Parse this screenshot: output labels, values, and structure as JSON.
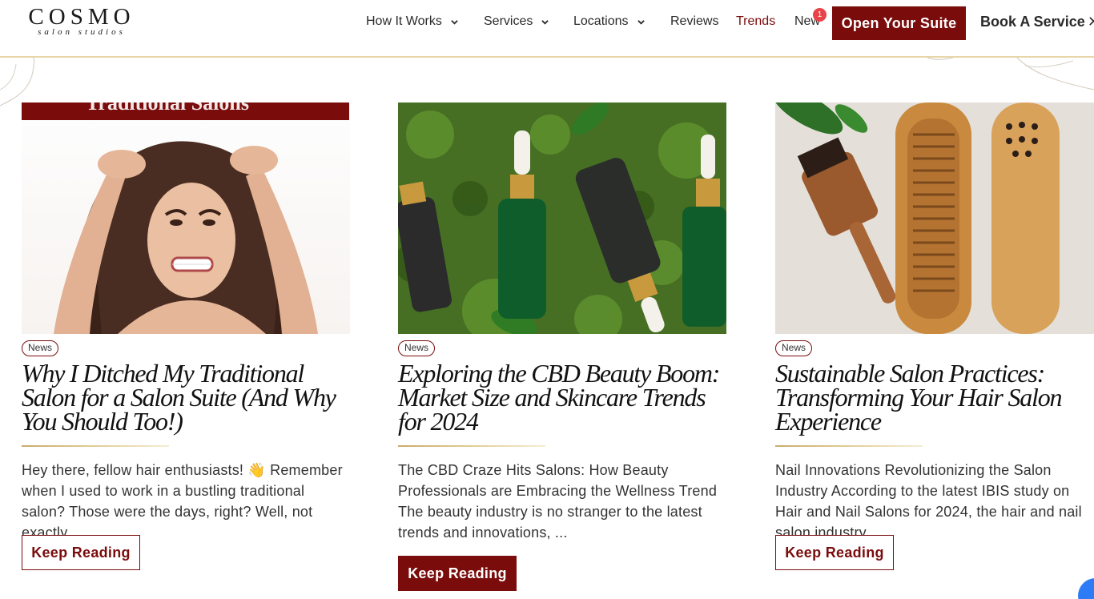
{
  "brand": {
    "name": "COSMO",
    "tagline": "salon studios"
  },
  "nav": {
    "items": [
      {
        "label": "How It Works",
        "dropdown": true
      },
      {
        "label": "Services",
        "dropdown": true
      },
      {
        "label": "Locations",
        "dropdown": true
      },
      {
        "label": "Reviews",
        "dropdown": false
      },
      {
        "label": "Trends",
        "dropdown": false,
        "active": true
      },
      {
        "label": "New",
        "dropdown": false
      }
    ],
    "new_badge": "1",
    "cta_primary": "Open Your Suite",
    "cta_secondary": "Book A Service"
  },
  "colors": {
    "accent": "#7a0c0c",
    "gold": "#c9ac6b",
    "badge": "#e8454a"
  },
  "posts": [
    {
      "tag": "News",
      "title": "Why I Ditched My Traditional Salon for a Salon Suite (And Why You Should Too!)",
      "excerpt": "Hey there, fellow hair enthusiasts! 👋 Remember when I used to work in a bustling traditional salon? Those were the days, right? Well, not exactly. ...",
      "button": "Keep Reading",
      "image": "woman-frustrated-hair-photo"
    },
    {
      "tag": "News",
      "title": "Exploring the CBD Beauty Boom: Market Size and Skincare Trends for 2024",
      "excerpt": "The CBD Craze Hits Salons: How Beauty Professionals are Embracing the Wellness Trend The beauty industry is no stranger to the latest trends and innovations, ...",
      "button": "Keep Reading",
      "image": "cbd-dropper-bottles-on-moss-photo"
    },
    {
      "tag": "News",
      "title": "Sustainable Salon Practices: Transforming Your Hair Salon Experience",
      "excerpt": "Nail Innovations Revolutionizing the Salon Industry According to the latest IBIS study on Hair and Nail Salons for 2024, the hair and nail salon industry ...",
      "button": "Keep Reading",
      "image": "wooden-combs-and-brushes-photo"
    }
  ]
}
